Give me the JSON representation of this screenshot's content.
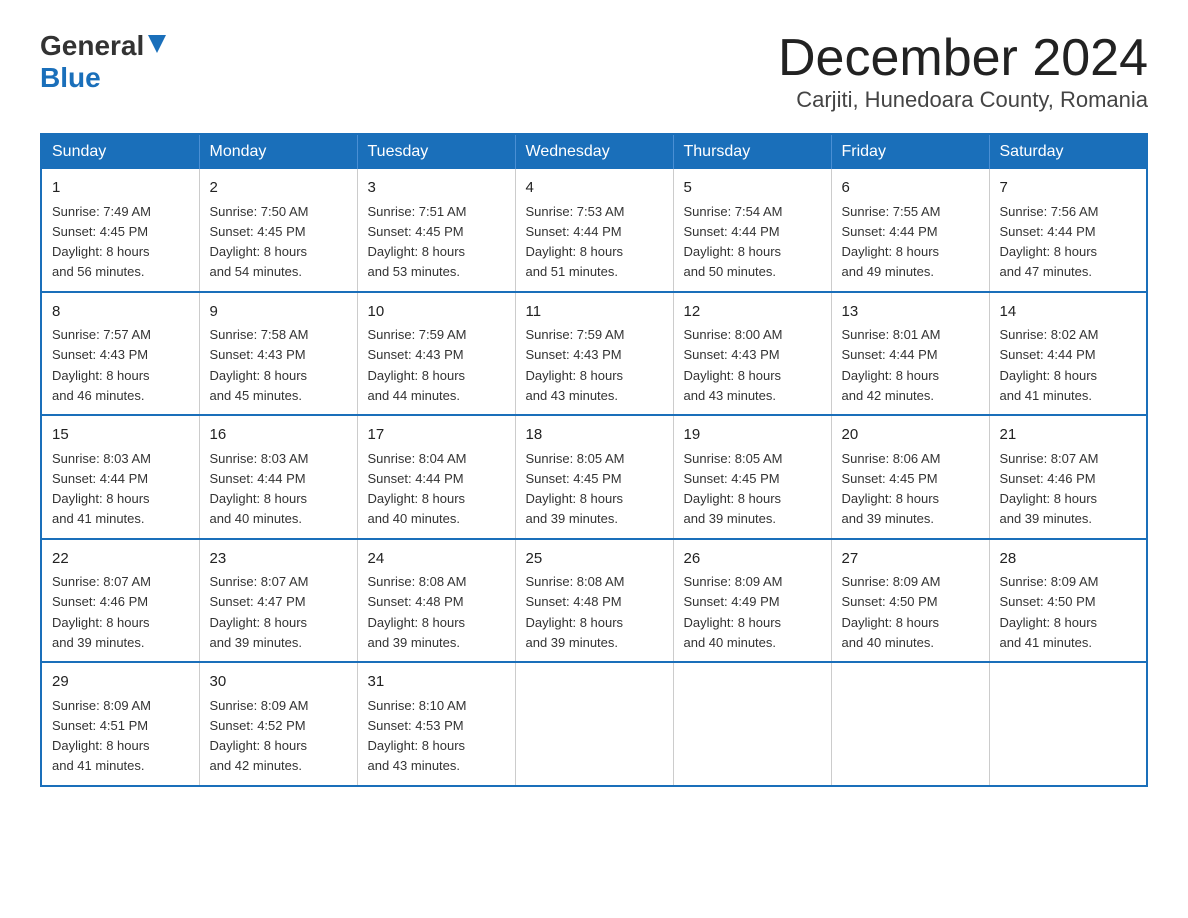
{
  "header": {
    "logo_general": "General",
    "logo_blue": "Blue",
    "month_title": "December 2024",
    "location": "Carjiti, Hunedoara County, Romania"
  },
  "days_of_week": [
    "Sunday",
    "Monday",
    "Tuesday",
    "Wednesday",
    "Thursday",
    "Friday",
    "Saturday"
  ],
  "weeks": [
    [
      {
        "day": "1",
        "sunrise": "7:49 AM",
        "sunset": "4:45 PM",
        "daylight": "8 hours and 56 minutes."
      },
      {
        "day": "2",
        "sunrise": "7:50 AM",
        "sunset": "4:45 PM",
        "daylight": "8 hours and 54 minutes."
      },
      {
        "day": "3",
        "sunrise": "7:51 AM",
        "sunset": "4:45 PM",
        "daylight": "8 hours and 53 minutes."
      },
      {
        "day": "4",
        "sunrise": "7:53 AM",
        "sunset": "4:44 PM",
        "daylight": "8 hours and 51 minutes."
      },
      {
        "day": "5",
        "sunrise": "7:54 AM",
        "sunset": "4:44 PM",
        "daylight": "8 hours and 50 minutes."
      },
      {
        "day": "6",
        "sunrise": "7:55 AM",
        "sunset": "4:44 PM",
        "daylight": "8 hours and 49 minutes."
      },
      {
        "day": "7",
        "sunrise": "7:56 AM",
        "sunset": "4:44 PM",
        "daylight": "8 hours and 47 minutes."
      }
    ],
    [
      {
        "day": "8",
        "sunrise": "7:57 AM",
        "sunset": "4:43 PM",
        "daylight": "8 hours and 46 minutes."
      },
      {
        "day": "9",
        "sunrise": "7:58 AM",
        "sunset": "4:43 PM",
        "daylight": "8 hours and 45 minutes."
      },
      {
        "day": "10",
        "sunrise": "7:59 AM",
        "sunset": "4:43 PM",
        "daylight": "8 hours and 44 minutes."
      },
      {
        "day": "11",
        "sunrise": "7:59 AM",
        "sunset": "4:43 PM",
        "daylight": "8 hours and 43 minutes."
      },
      {
        "day": "12",
        "sunrise": "8:00 AM",
        "sunset": "4:43 PM",
        "daylight": "8 hours and 43 minutes."
      },
      {
        "day": "13",
        "sunrise": "8:01 AM",
        "sunset": "4:44 PM",
        "daylight": "8 hours and 42 minutes."
      },
      {
        "day": "14",
        "sunrise": "8:02 AM",
        "sunset": "4:44 PM",
        "daylight": "8 hours and 41 minutes."
      }
    ],
    [
      {
        "day": "15",
        "sunrise": "8:03 AM",
        "sunset": "4:44 PM",
        "daylight": "8 hours and 41 minutes."
      },
      {
        "day": "16",
        "sunrise": "8:03 AM",
        "sunset": "4:44 PM",
        "daylight": "8 hours and 40 minutes."
      },
      {
        "day": "17",
        "sunrise": "8:04 AM",
        "sunset": "4:44 PM",
        "daylight": "8 hours and 40 minutes."
      },
      {
        "day": "18",
        "sunrise": "8:05 AM",
        "sunset": "4:45 PM",
        "daylight": "8 hours and 39 minutes."
      },
      {
        "day": "19",
        "sunrise": "8:05 AM",
        "sunset": "4:45 PM",
        "daylight": "8 hours and 39 minutes."
      },
      {
        "day": "20",
        "sunrise": "8:06 AM",
        "sunset": "4:45 PM",
        "daylight": "8 hours and 39 minutes."
      },
      {
        "day": "21",
        "sunrise": "8:07 AM",
        "sunset": "4:46 PM",
        "daylight": "8 hours and 39 minutes."
      }
    ],
    [
      {
        "day": "22",
        "sunrise": "8:07 AM",
        "sunset": "4:46 PM",
        "daylight": "8 hours and 39 minutes."
      },
      {
        "day": "23",
        "sunrise": "8:07 AM",
        "sunset": "4:47 PM",
        "daylight": "8 hours and 39 minutes."
      },
      {
        "day": "24",
        "sunrise": "8:08 AM",
        "sunset": "4:48 PM",
        "daylight": "8 hours and 39 minutes."
      },
      {
        "day": "25",
        "sunrise": "8:08 AM",
        "sunset": "4:48 PM",
        "daylight": "8 hours and 39 minutes."
      },
      {
        "day": "26",
        "sunrise": "8:09 AM",
        "sunset": "4:49 PM",
        "daylight": "8 hours and 40 minutes."
      },
      {
        "day": "27",
        "sunrise": "8:09 AM",
        "sunset": "4:50 PM",
        "daylight": "8 hours and 40 minutes."
      },
      {
        "day": "28",
        "sunrise": "8:09 AM",
        "sunset": "4:50 PM",
        "daylight": "8 hours and 41 minutes."
      }
    ],
    [
      {
        "day": "29",
        "sunrise": "8:09 AM",
        "sunset": "4:51 PM",
        "daylight": "8 hours and 41 minutes."
      },
      {
        "day": "30",
        "sunrise": "8:09 AM",
        "sunset": "4:52 PM",
        "daylight": "8 hours and 42 minutes."
      },
      {
        "day": "31",
        "sunrise": "8:10 AM",
        "sunset": "4:53 PM",
        "daylight": "8 hours and 43 minutes."
      },
      null,
      null,
      null,
      null
    ]
  ],
  "labels": {
    "sunrise": "Sunrise:",
    "sunset": "Sunset:",
    "daylight": "Daylight:"
  }
}
